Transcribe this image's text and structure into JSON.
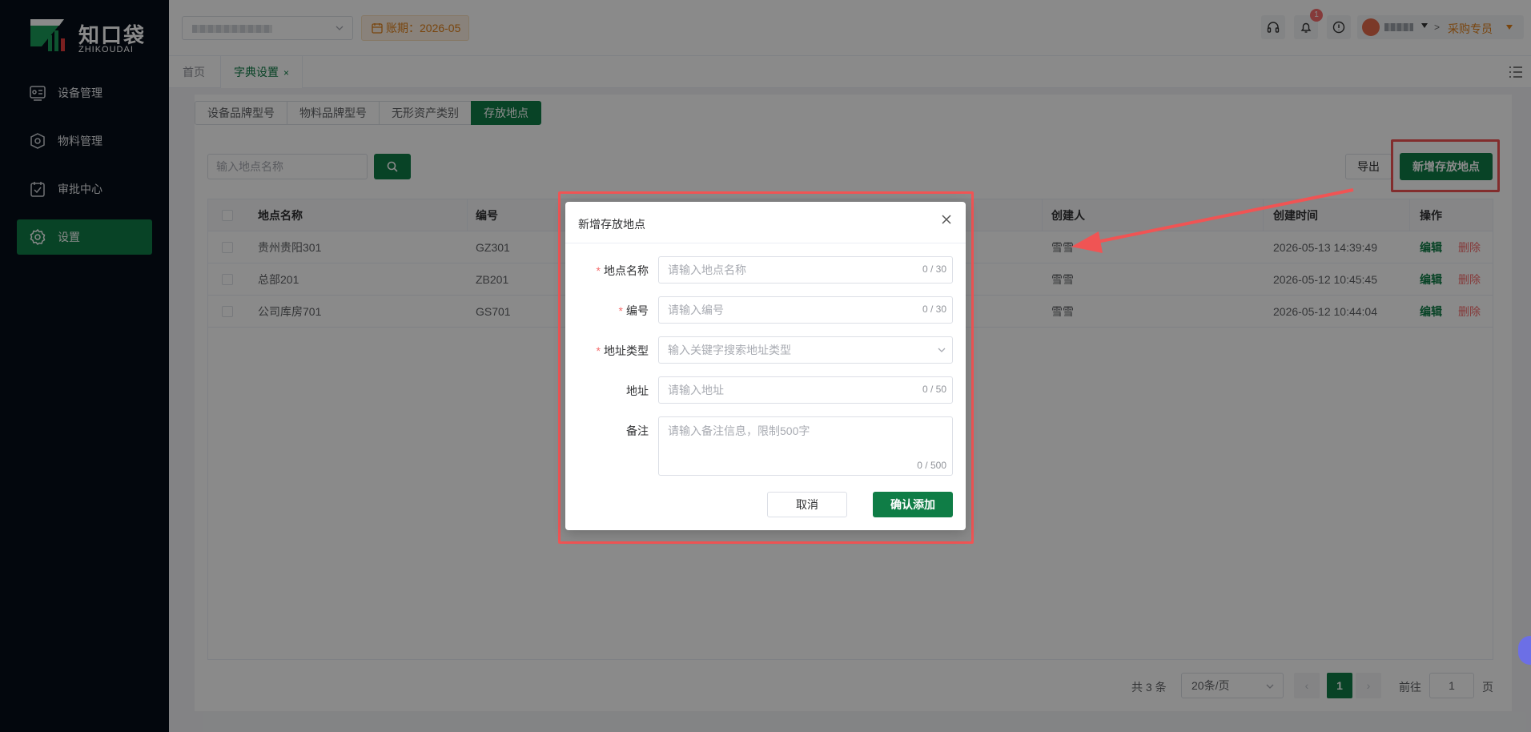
{
  "brand": {
    "name": "知口袋",
    "sub": "ZHIKOUDAI",
    "color": "#0f7d46"
  },
  "sidebar": {
    "items": [
      {
        "label": "设备管理",
        "icon": "device-icon"
      },
      {
        "label": "物料管理",
        "icon": "material-icon"
      },
      {
        "label": "审批中心",
        "icon": "approval-icon"
      },
      {
        "label": "设置",
        "icon": "gear-icon",
        "active": true
      }
    ]
  },
  "header": {
    "period": "账期：2026-05",
    "notification_count": "1",
    "role": "采购专员",
    "user_sep": ">"
  },
  "tabs": {
    "home": "首页",
    "active": "字典设置",
    "close": "×"
  },
  "segments": [
    "设备品牌型号",
    "物料品牌型号",
    "无形资产类别",
    "存放地点"
  ],
  "toolbar": {
    "search_placeholder": "输入地点名称",
    "export_label": "导出",
    "add_label": "新增存放地点"
  },
  "table": {
    "columns": [
      "地点名称",
      "编号",
      "创建人",
      "创建时间",
      "操作"
    ],
    "rows": [
      {
        "name": "贵州贵阳301",
        "code": "GZ301",
        "creator": "雪雪",
        "created": "2026-05-13 14:39:49"
      },
      {
        "name": "总部201",
        "code": "ZB201",
        "creator": "雪雪",
        "created": "2026-05-12 10:45:45"
      },
      {
        "name": "公司库房701",
        "code": "GS701",
        "creator": "雪雪",
        "created": "2026-05-12 10:44:04"
      }
    ],
    "edit_label": "编辑",
    "delete_label": "删除"
  },
  "pagination": {
    "total": "共 3 条",
    "page_size": "20条/页",
    "current": "1",
    "goto": "前往",
    "goto_value": "1",
    "page_suffix": "页",
    "prev": "‹",
    "next": "›"
  },
  "dialog": {
    "title": "新增存放地点",
    "fields": {
      "name": {
        "label": "地点名称",
        "placeholder": "请输入地点名称",
        "counter": "0 / 30"
      },
      "code": {
        "label": "编号",
        "placeholder": "请输入编号",
        "counter": "0 / 30"
      },
      "type": {
        "label": "地址类型",
        "placeholder": "输入关键字搜索地址类型"
      },
      "address": {
        "label": "地址",
        "placeholder": "请输入地址",
        "counter": "0 / 50"
      },
      "remark": {
        "label": "备注",
        "placeholder": "请输入备注信息，限制500字",
        "counter": "0 / 500"
      }
    },
    "required_mark": "*",
    "cancel_label": "取消",
    "confirm_label": "确认添加"
  }
}
